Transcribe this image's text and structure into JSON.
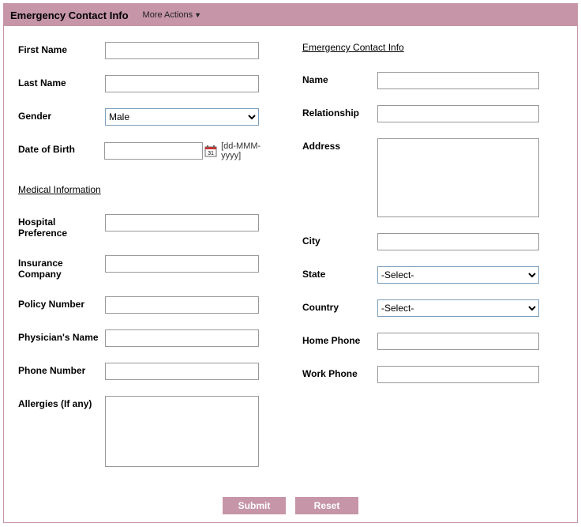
{
  "header": {
    "title": "Emergency Contact Info",
    "more_actions": "More Actions"
  },
  "left": {
    "first_name_label": "First Name",
    "first_name_value": "",
    "last_name_label": "Last Name",
    "last_name_value": "",
    "gender_label": "Gender",
    "gender_value": "Male",
    "dob_label": "Date of Birth",
    "dob_value": "",
    "dob_hint": "[dd-MMM-yyyy]",
    "medical_section": "Medical Information",
    "hospital_label": "Hospital Preference",
    "hospital_value": "",
    "insurance_label": "Insurance Company",
    "insurance_value": "",
    "policy_label": "Policy Number",
    "policy_value": "",
    "physician_label": "Physician's Name",
    "physician_value": "",
    "phone_label": "Phone Number",
    "phone_value": "",
    "allergies_label": "Allergies (If any)",
    "allergies_value": ""
  },
  "right": {
    "section": "Emergency Contact Info",
    "name_label": "Name",
    "name_value": "",
    "relationship_label": "Relationship",
    "relationship_value": "",
    "address_label": "Address",
    "address_value": "",
    "city_label": "City",
    "city_value": "",
    "state_label": "State",
    "state_value": "-Select-",
    "country_label": "Country",
    "country_value": "-Select-",
    "home_phone_label": "Home Phone",
    "home_phone_value": "",
    "work_phone_label": "Work Phone",
    "work_phone_value": ""
  },
  "footer": {
    "submit": "Submit",
    "reset": "Reset"
  }
}
